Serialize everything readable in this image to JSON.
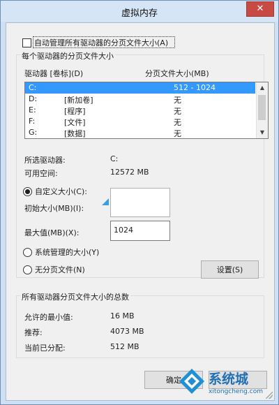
{
  "dialog": {
    "title": "虚拟内存",
    "close_glyph": "✕"
  },
  "auto_manage": {
    "label": "自动管理所有驱动器的分页文件大小(A)",
    "checked": false
  },
  "per_drive": {
    "group_title": "每个驱动器的分页文件大小",
    "col_drive": "驱动器 [卷标](D)",
    "col_size": "分页文件大小(MB)",
    "drives": [
      {
        "letter": "C:",
        "label": "",
        "size": "512 - 1024",
        "selected": true
      },
      {
        "letter": "D:",
        "label": "[新加卷]",
        "size": "无",
        "selected": false
      },
      {
        "letter": "E:",
        "label": "[程序]",
        "size": "无",
        "selected": false
      },
      {
        "letter": "F:",
        "label": "[文件]",
        "size": "无",
        "selected": false
      },
      {
        "letter": "G:",
        "label": "[数据]",
        "size": "无",
        "selected": false
      }
    ],
    "selected_drive_label": "所选驱动器:",
    "selected_drive_value": "C:",
    "free_space_label": "可用空间:",
    "free_space_value": "12572 MB",
    "custom_size_label": "自定义大小(C):",
    "initial_size_label": "初始大小(MB)(I):",
    "initial_size_value": "",
    "max_size_label": "最大值(MB)(X):",
    "max_size_value": "1024",
    "system_managed_label": "系统管理的大小(Y)",
    "no_paging_label": "无分页文件(N)",
    "set_button": "设置(S)",
    "selected_option": "custom"
  },
  "totals": {
    "group_title": "所有驱动器分页文件大小的总数",
    "min_allowed_label": "允许的最小值:",
    "min_allowed_value": "16 MB",
    "recommended_label": "推荐:",
    "recommended_value": "4073 MB",
    "current_label": "当前已分配:",
    "current_value": "512 MB"
  },
  "footer": {
    "ok_button": "确定"
  },
  "watermark": {
    "brand": "系统城",
    "url": "xitongcheng.com"
  }
}
